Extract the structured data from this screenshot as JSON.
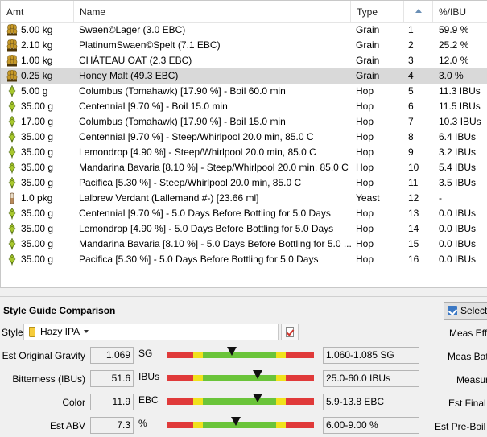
{
  "table": {
    "headers": {
      "amt": "Amt",
      "name": "Name",
      "type": "Type",
      "pct": "%/IBU"
    },
    "rows": [
      {
        "amt": "5.00 kg",
        "name": "Swaen©Lager (3.0 EBC)",
        "type": "Grain",
        "num": "1",
        "pct": "59.9 %",
        "icon": "grain-icon"
      },
      {
        "amt": "2.10 kg",
        "name": "PlatinumSwaen©Spelt (7.1 EBC)",
        "type": "Grain",
        "num": "2",
        "pct": "25.2 %",
        "icon": "grain-icon"
      },
      {
        "amt": "1.00 kg",
        "name": "CHÂTEAU OAT (2.3 EBC)",
        "type": "Grain",
        "num": "3",
        "pct": "12.0 %",
        "icon": "grain-icon"
      },
      {
        "amt": "0.25 kg",
        "name": "Honey Malt (49.3 EBC)",
        "type": "Grain",
        "num": "4",
        "pct": "3.0 %",
        "icon": "grain-icon",
        "selected": true
      },
      {
        "amt": "5.00 g",
        "name": "Columbus (Tomahawk) [17.90 %] - Boil 60.0 min",
        "type": "Hop",
        "num": "5",
        "pct": "11.3 IBUs",
        "icon": "hop-icon"
      },
      {
        "amt": "35.00 g",
        "name": "Centennial [9.70 %] - Boil 15.0 min",
        "type": "Hop",
        "num": "6",
        "pct": "11.5 IBUs",
        "icon": "hop-icon"
      },
      {
        "amt": "17.00 g",
        "name": "Columbus (Tomahawk) [17.90 %] - Boil 15.0 min",
        "type": "Hop",
        "num": "7",
        "pct": "10.3 IBUs",
        "icon": "hop-icon"
      },
      {
        "amt": "35.00 g",
        "name": "Centennial [9.70 %] - Steep/Whirlpool  20.0 min, 85.0 C",
        "type": "Hop",
        "num": "8",
        "pct": "6.4 IBUs",
        "icon": "hop-icon"
      },
      {
        "amt": "35.00 g",
        "name": "Lemondrop [4.90 %] - Steep/Whirlpool  20.0 min, 85.0 C",
        "type": "Hop",
        "num": "9",
        "pct": "3.2 IBUs",
        "icon": "hop-icon"
      },
      {
        "amt": "35.00 g",
        "name": "Mandarina Bavaria [8.10 %] - Steep/Whirlpool  20.0 min, 85.0 C",
        "type": "Hop",
        "num": "10",
        "pct": "5.4 IBUs",
        "icon": "hop-icon"
      },
      {
        "amt": "35.00 g",
        "name": "Pacifica [5.30 %] - Steep/Whirlpool  20.0 min, 85.0 C",
        "type": "Hop",
        "num": "11",
        "pct": "3.5 IBUs",
        "icon": "hop-icon"
      },
      {
        "amt": "1.0 pkg",
        "name": "Lalbrew Verdant (Lallemand #-) [23.66 ml]",
        "type": "Yeast",
        "num": "12",
        "pct": "-",
        "icon": "yeast-icon"
      },
      {
        "amt": "35.00 g",
        "name": "Centennial [9.70 %] - 5.0 Days Before Bottling for 5.0 Days",
        "type": "Hop",
        "num": "13",
        "pct": "0.0 IBUs",
        "icon": "hop-icon"
      },
      {
        "amt": "35.00 g",
        "name": "Lemondrop [4.90 %] - 5.0 Days Before Bottling for 5.0 Days",
        "type": "Hop",
        "num": "14",
        "pct": "0.0 IBUs",
        "icon": "hop-icon"
      },
      {
        "amt": "35.00 g",
        "name": "Mandarina Bavaria [8.10 %] - 5.0 Days Before Bottling for 5.0 ...",
        "type": "Hop",
        "num": "15",
        "pct": "0.0 IBUs",
        "icon": "hop-icon"
      },
      {
        "amt": "35.00 g",
        "name": "Pacifica [5.30 %] - 5.0 Days Before Bottling for 5.0 Days",
        "type": "Hop",
        "num": "16",
        "pct": "0.0 IBUs",
        "icon": "hop-icon"
      }
    ]
  },
  "style_guide": {
    "title": "Style Guide Comparison",
    "style_label": "Style",
    "style_value": "Hazy IPA",
    "select_button": "Select",
    "params": [
      {
        "label": "Est Original Gravity",
        "value": "1.069",
        "unit": "SG",
        "range": "1.060-1.085 SG",
        "marker_fraction": 0.44
      },
      {
        "label": "Bitterness (IBUs)",
        "value": "51.6",
        "unit": "IBUs",
        "range": "25.0-60.0 IBUs",
        "marker_fraction": 0.62
      },
      {
        "label": "Color",
        "value": "11.9",
        "unit": "EBC",
        "range": "5.9-13.8 EBC",
        "marker_fraction": 0.62
      },
      {
        "label": "Est ABV",
        "value": "7.3",
        "unit": "%",
        "range": "6.00-9.00 %",
        "marker_fraction": 0.47
      }
    ],
    "right_labels": [
      "Meas Effi",
      "Meas Bat",
      "Measur",
      "Est Final G",
      "Est Pre-Boil G"
    ]
  },
  "colors": {
    "gauge_red": "#e03a3a",
    "gauge_yellow": "#f0e21c",
    "gauge_green": "#6ac43a",
    "selected_row": "#d9d9d9"
  }
}
